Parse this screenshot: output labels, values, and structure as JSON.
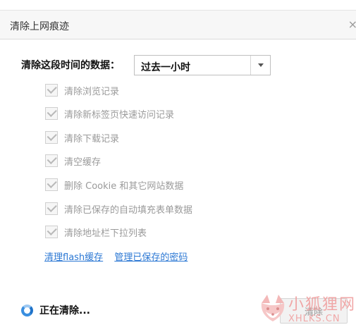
{
  "dialog": {
    "title": "清除上网痕迹",
    "close_glyph": "×"
  },
  "time_range": {
    "label": "清除这段时间的数据：",
    "selected": "过去一小时"
  },
  "options": [
    {
      "label": "清除浏览记录",
      "checked": true
    },
    {
      "label": "清除新标签页快速访问记录",
      "checked": true
    },
    {
      "label": "清除下载记录",
      "checked": true
    },
    {
      "label": "清空缓存",
      "checked": true
    },
    {
      "label": "删除 Cookie 和其它网站数据",
      "checked": true
    },
    {
      "label": "清除已保存的自动填充表单数据",
      "checked": true
    },
    {
      "label": "清除地址栏下拉列表",
      "checked": true
    }
  ],
  "links": {
    "flash": "清理flash缓存",
    "passwords": "管理已保存的密码"
  },
  "footer": {
    "status": "正在清除...",
    "clear_button": "清除"
  },
  "watermark": {
    "name": "小狐狸网",
    "domain": "XHLKS.CN"
  },
  "colors": {
    "link": "#2c78d4",
    "spinner": "#3a8fe0",
    "watermark": "#f0a1a1"
  }
}
